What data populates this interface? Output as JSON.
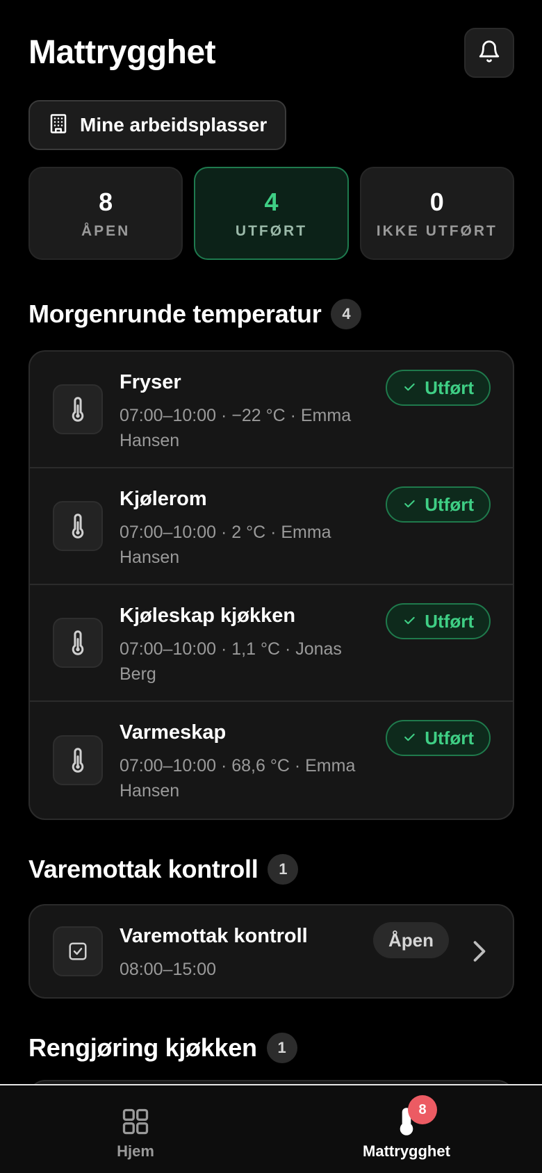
{
  "header": {
    "title": "Mattrygghet",
    "notifications_icon": "bell-icon"
  },
  "workplaces": {
    "label": "Mine arbeidsplasser",
    "icon": "building-icon"
  },
  "stats": [
    {
      "value": "8",
      "label": "ÅPEN",
      "active": false
    },
    {
      "value": "4",
      "label": "UTFØRT",
      "active": true
    },
    {
      "value": "0",
      "label": "IKKE UTFØRT",
      "active": false
    }
  ],
  "sections": [
    {
      "title": "Morgenrunde temperatur",
      "count": "4",
      "tasks": [
        {
          "name": "Fryser",
          "meta": "07:00–10:00 · −22 °C · Emma Hansen",
          "status": "Utført",
          "icon": "thermometer-icon"
        },
        {
          "name": "Kjølerom",
          "meta": "07:00–10:00 · 2 °C · Emma Hansen",
          "status": "Utført",
          "icon": "thermometer-icon"
        },
        {
          "name": "Kjøleskap kjøkken",
          "meta": "07:00–10:00 · 1,1 °C · Jonas Berg",
          "status": "Utført",
          "icon": "thermometer-icon"
        },
        {
          "name": "Varmeskap",
          "meta": "07:00–10:00 · 68,6 °C · Emma Hansen",
          "status": "Utført",
          "icon": "thermometer-icon"
        }
      ]
    },
    {
      "title": "Varemottak kontroll",
      "count": "1",
      "tasks": [
        {
          "name": "Varemottak kontroll",
          "meta": "08:00–15:00",
          "status": "Åpen",
          "icon": "checkbox-icon"
        }
      ]
    },
    {
      "title": "Rengjøring kjøkken",
      "count": "1"
    }
  ],
  "nav": {
    "home_label": "Hjem",
    "food_safety_label": "Mattrygghet",
    "food_safety_badge": "8"
  },
  "colors": {
    "accent_green": "#3fcf85",
    "badge_red": "#ec5b63",
    "background": "#000000"
  }
}
